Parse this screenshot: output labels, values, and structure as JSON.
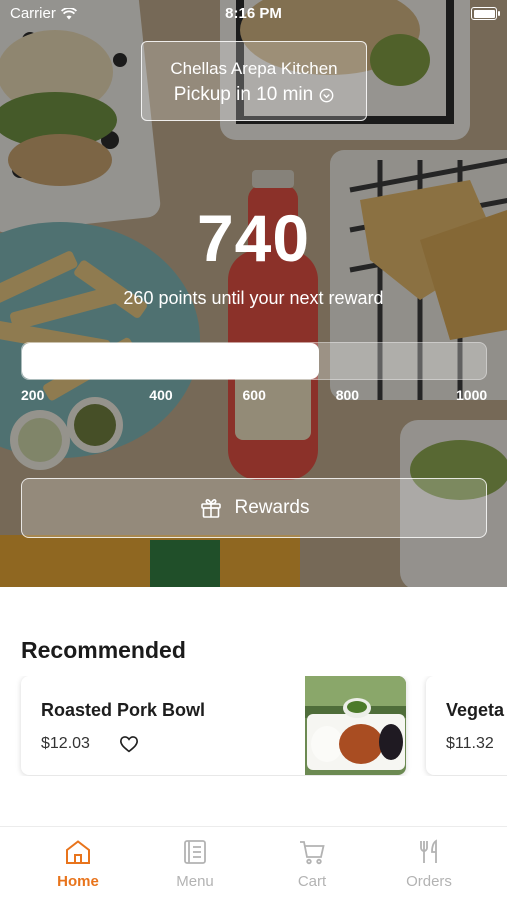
{
  "status_bar": {
    "carrier": "Carrier",
    "time": "8:16 PM"
  },
  "store": {
    "name": "Chellas Arepa Kitchen",
    "pickup": "Pickup in 10 min"
  },
  "rewards": {
    "points": "740",
    "note": "260 points until your next reward",
    "progress_value": 740,
    "scale_min": 100,
    "scale_max": 1100,
    "ticks": [
      "200",
      "400",
      "600",
      "800",
      "1000"
    ],
    "button_label": "Rewards"
  },
  "recommended": {
    "title": "Recommended",
    "items": [
      {
        "name": "Roasted Pork Bowl",
        "price": "$12.03"
      },
      {
        "name": "Vegeta",
        "price": "$11.32"
      }
    ]
  },
  "tabs": [
    {
      "label": "Home",
      "icon": "home-icon",
      "active": true
    },
    {
      "label": "Menu",
      "icon": "menu-icon",
      "active": false
    },
    {
      "label": "Cart",
      "icon": "cart-icon",
      "active": false
    },
    {
      "label": "Orders",
      "icon": "orders-icon",
      "active": false
    }
  ],
  "colors": {
    "accent": "#e8741c",
    "inactive": "#b3b3b3"
  }
}
